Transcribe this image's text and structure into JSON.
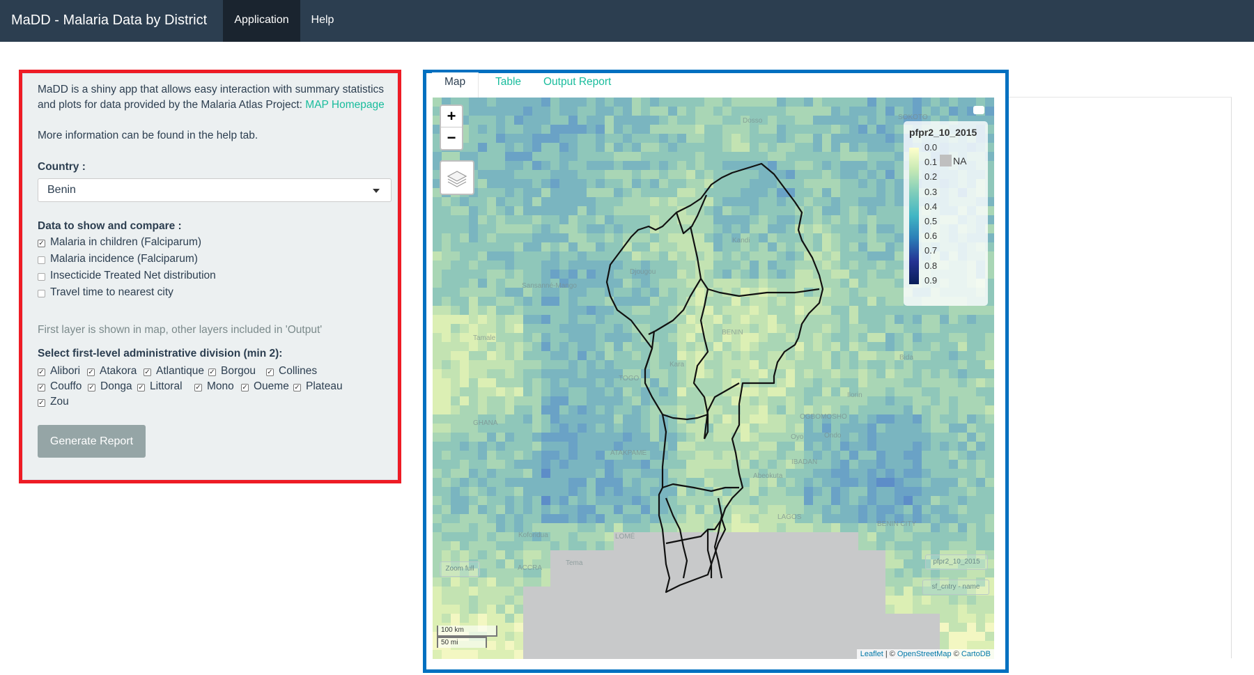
{
  "navbar": {
    "brand": "MaDD - Malaria Data by District",
    "items": [
      {
        "label": "Application",
        "active": true
      },
      {
        "label": "Help",
        "active": false
      }
    ]
  },
  "sidebar": {
    "intro_text": "MaDD is a shiny app that allows easy interaction with summary statistics",
    "intro_text2": "and plots for data provided by the Malaria Atlas Project:",
    "intro_link": "MAP Homepage",
    "info_text": "More information can be found in the help tab.",
    "country_label": "Country :",
    "country_value": "Benin",
    "data_label": "Data to show and compare :",
    "data_options": [
      {
        "label": "Malaria in children (Falciparum)",
        "checked": true
      },
      {
        "label": "Malaria incidence (Falciparum)",
        "checked": false
      },
      {
        "label": "Insecticide Treated Net distribution",
        "checked": false
      },
      {
        "label": "Travel time to nearest city",
        "checked": false
      }
    ],
    "layer_note": "First layer is shown in map, other layers included in 'Output'",
    "admin_label": "Select first-level administrative division (min 2):",
    "admin_options": [
      {
        "label": "Alibori",
        "checked": true
      },
      {
        "label": "Atakora",
        "checked": true
      },
      {
        "label": "Atlantique",
        "checked": true
      },
      {
        "label": "Borgou",
        "checked": true
      },
      {
        "label": "Collines",
        "checked": true
      },
      {
        "label": "Couffo",
        "checked": true
      },
      {
        "label": "Donga",
        "checked": true
      },
      {
        "label": "Littoral",
        "checked": true
      },
      {
        "label": "Mono",
        "checked": true
      },
      {
        "label": "Oueme",
        "checked": true
      },
      {
        "label": "Plateau",
        "checked": true
      },
      {
        "label": "Zou",
        "checked": true
      }
    ],
    "generate_button": "Generate Report"
  },
  "main": {
    "tabs": [
      {
        "label": "Map",
        "active": true
      },
      {
        "label": "Table",
        "active": false
      },
      {
        "label": "Output Report",
        "active": false
      }
    ],
    "map": {
      "zoom_in": "+",
      "zoom_out": "−",
      "legend": {
        "title": "pfpr2_10_2015",
        "ticks": [
          "0.0",
          "0.1",
          "0.2",
          "0.3",
          "0.4",
          "0.5",
          "0.6",
          "0.7",
          "0.8",
          "0.9"
        ],
        "na_label": "NA",
        "colors": [
          "#ffffcc",
          "#c7e9b4",
          "#7fcdbb",
          "#41b6c4",
          "#2c7fb8",
          "#253494",
          "#081d58"
        ]
      },
      "zoom_full": "Zoom full",
      "layer_btn_1": "pfpr2_10_2015",
      "layer_btn_2": "sf_cntry - name",
      "scale_km": "100 km",
      "scale_mi": "50 mi",
      "attribution_leaflet": "Leaflet",
      "attribution_sep": "| ©",
      "attribution_osm": "OpenStreetMap",
      "attribution_sep2": "©",
      "attribution_carto": "CartoDB",
      "cities": [
        "Dosso",
        "SOKOTO",
        "Kandi",
        "Sansanné-Mango",
        "Djougou",
        "BENIN",
        "Tamale",
        "TOGO",
        "Ilorin",
        "OGBOMOSHO",
        "GHANA",
        "ATAKPAME",
        "Oyo",
        "IBADAN",
        "LOMÉ",
        "LAGOS",
        "BENIN CITY",
        "Koforidua",
        "ACCRA",
        "Tema",
        "Bida",
        "Kara",
        "Ondo",
        "Abeokuta"
      ]
    }
  }
}
